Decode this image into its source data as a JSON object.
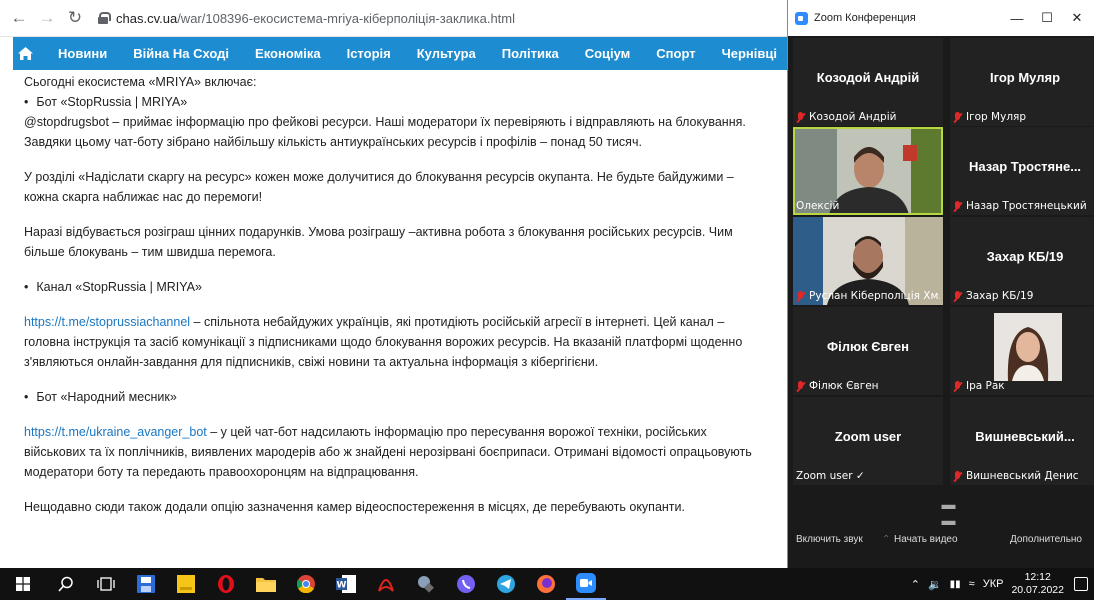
{
  "browser": {
    "url_host": "chas.cv.ua",
    "url_path": "/war/108396-екосистема-mriya-кіберполіція-заклика.html",
    "nav": [
      "Новини",
      "Війна На Сході",
      "Економіка",
      "Історія",
      "Культура",
      "Політика",
      "Соціум",
      "Спорт",
      "Чернівці"
    ],
    "article": {
      "intro": "Сьогодні екосистема «MRIYA» включає:",
      "b1_title": "Бот «StopRussia | MRIYA»",
      "b1_text": "@stopdrugsbot – приймає інформацію про фейкові ресурси. Наші модератори їх перевіряють і відправляють на блокування. Завдяки цьому чат-боту зібрано найбільшу кількість антиукраїнських ресурсів і профілів – понад 50 тисяч.",
      "p2": "У розділі «Надіслати скаргу на ресурс» кожен може долучитися до блокування ресурсів окупанта. Не будьте байдужими – кожна скарга наближає нас до перемоги!",
      "p3": "Наразі відбувається розіграш цінних подарунків. Умова розіграшу –активна робота з блокування російських ресурсів. Чим більше блокувань – тим швидша перемога.",
      "b2_title": "Канал «StopRussia | MRIYA»",
      "b2_link": "https://t.me/stoprussiachannel",
      "b2_text": " – спільнота небайдужих українців, які протидіють російській агресії в інтернеті. Цей канал – головна інструкція та засіб комунікації з підписниками щодо блокування ворожих ресурсів. На вказаній платформі щоденно з'являються онлайн-завдання для підписників, свіжі новини та актуальна інформація з кібергігієни.",
      "b3_title": "Бот «Народний месник»",
      "b3_link": "https://t.me/ukraine_avanger_bot",
      "b3_text": " – у цей чат-бот надсилають інформацію про пересування ворожої техніки, російських військових та їх поплічників, виявлених мародерів або ж знайдені нерозірвані боєприпаси. Отримані відомості опрацьовують модератори боту та передають правоохоронцям на відпрацювання.",
      "p_last": "Нещодавно сюди також додали опцію зазначення камер відеоспостереження в місцях, де перебувають окупанти."
    }
  },
  "zoom": {
    "title": "Zoom Конференция",
    "tiles": [
      {
        "name": "Козодой Андрій",
        "label": "Козодой Андрій"
      },
      {
        "name": "Ігор Муляр",
        "label": "Ігор Муляр"
      },
      {
        "name": "",
        "label": "Олексій"
      },
      {
        "name": "Назар Тростяне...",
        "label": "Назар Тростянецький"
      },
      {
        "name": "",
        "label": "Руслан Кіберполіція Хм..."
      },
      {
        "name": "Захар КБ/19",
        "label": "Захар КБ/19"
      },
      {
        "name": "Філюк Євген",
        "label": "Філюк Євген"
      },
      {
        "name": "",
        "label": "Іра Рак"
      },
      {
        "name": "Zoom user",
        "label": "Zoom user ✓"
      },
      {
        "name": "Вишневський...",
        "label": "Вишневський Денис"
      }
    ],
    "footer": {
      "unmute": "Включить звук",
      "start_video": "Начать видео",
      "more": "Дополнительно"
    }
  },
  "taskbar": {
    "lang": "УКР",
    "time": "12:12",
    "date": "20.07.2022"
  }
}
